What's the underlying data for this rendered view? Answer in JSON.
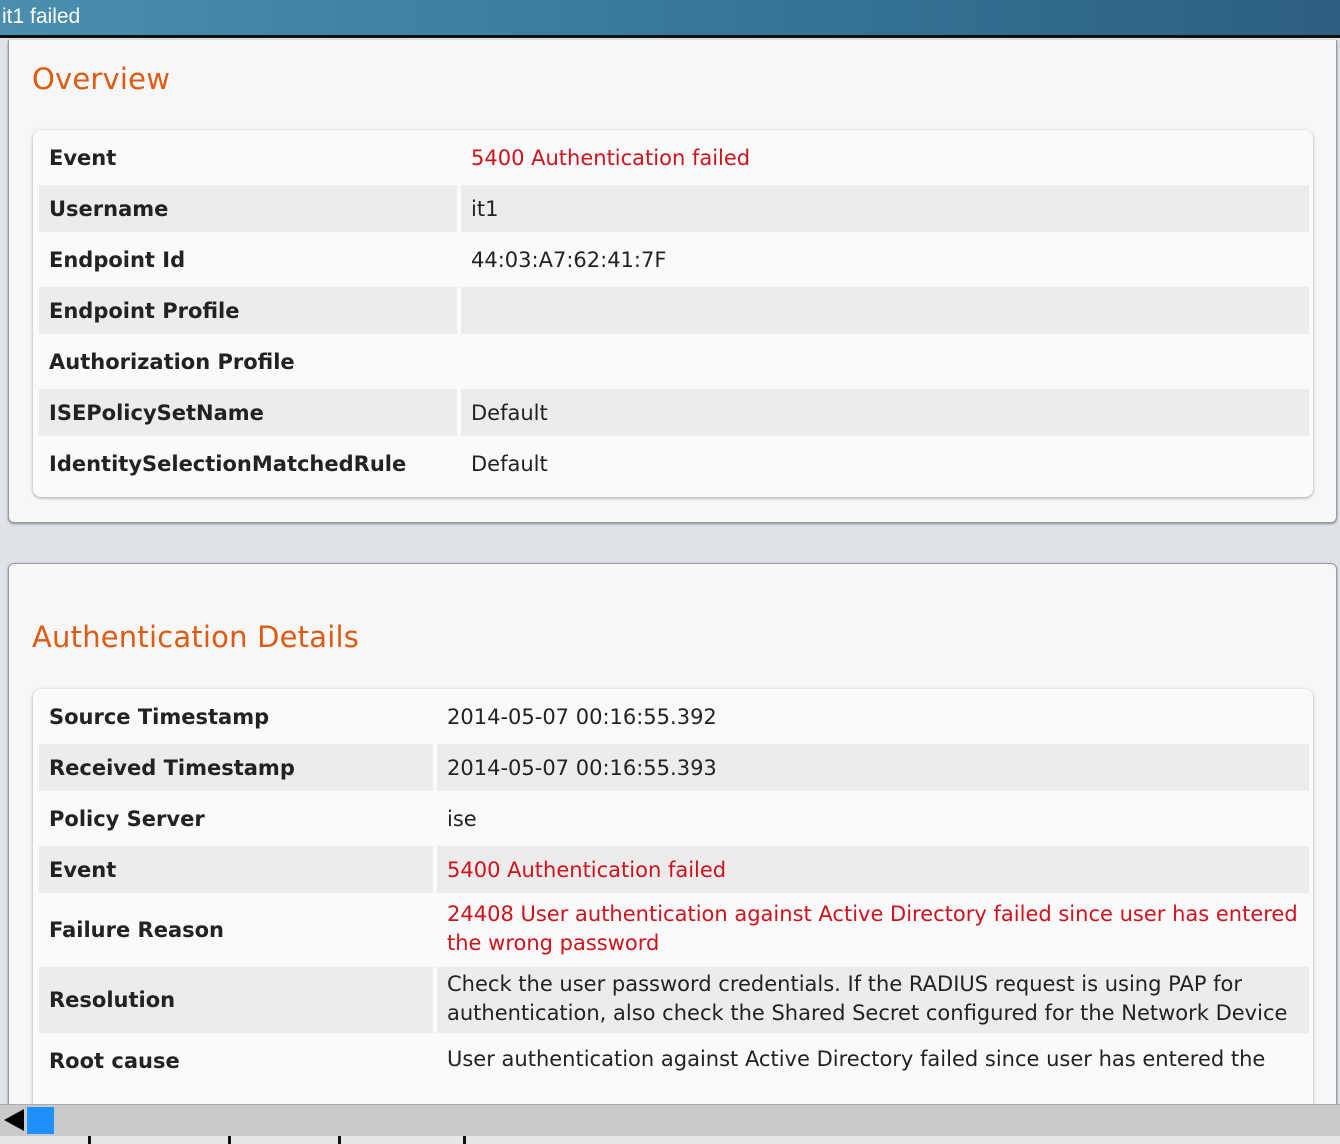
{
  "window": {
    "title": "it1 failed"
  },
  "overview": {
    "heading": "Overview",
    "rows": [
      {
        "label": "Event",
        "value": "5400 Authentication failed",
        "highlight": true
      },
      {
        "label": "Username",
        "value": "it1"
      },
      {
        "label": "Endpoint Id",
        "value": "44:03:A7:62:41:7F"
      },
      {
        "label": "Endpoint Profile",
        "value": ""
      },
      {
        "label": "Authorization Profile",
        "value": ""
      },
      {
        "label": "ISEPolicySetName",
        "value": "Default"
      },
      {
        "label": "IdentitySelectionMatchedRule",
        "value": "Default"
      }
    ]
  },
  "auth_details": {
    "heading": "Authentication Details",
    "rows": [
      {
        "label": "Source Timestamp",
        "value": "2014-05-07 00:16:55.392"
      },
      {
        "label": "Received Timestamp",
        "value": "2014-05-07 00:16:55.393"
      },
      {
        "label": "Policy Server",
        "value": "ise"
      },
      {
        "label": "Event",
        "value": "5400 Authentication failed",
        "highlight": true
      },
      {
        "label": "Failure Reason",
        "value": "24408 User authentication against Active Directory failed since user has entered the wrong password",
        "highlight": true
      },
      {
        "label": "Resolution",
        "value": "Check the user password credentials. If the RADIUS request is using PAP for authentication, also check the Shared Secret configured for the Network Device"
      },
      {
        "label": "Root cause",
        "value": "User authentication against Active Directory failed since user has entered the"
      }
    ]
  },
  "colors": {
    "heading": "#e05a12",
    "error_text": "#d1111b",
    "titlebar": "#3a7ea0",
    "scroll_thumb": "#1e90ff"
  },
  "icons": {
    "scroll_left": "scroll-left-arrow-icon"
  }
}
